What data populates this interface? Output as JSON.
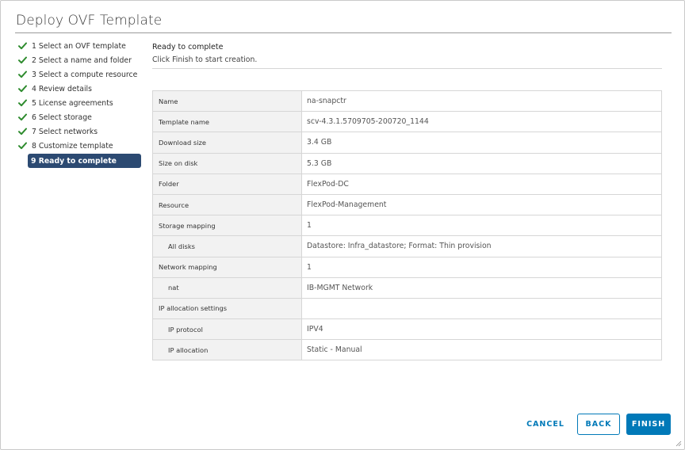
{
  "dialog": {
    "title": "Deploy OVF Template"
  },
  "steps": [
    {
      "label": "1 Select an OVF template",
      "done": true
    },
    {
      "label": "2 Select a name and folder",
      "done": true
    },
    {
      "label": "3 Select a compute resource",
      "done": true
    },
    {
      "label": "4 Review details",
      "done": true
    },
    {
      "label": "5 License agreements",
      "done": true
    },
    {
      "label": "6 Select storage",
      "done": true
    },
    {
      "label": "7 Select networks",
      "done": true
    },
    {
      "label": "8 Customize template",
      "done": true
    },
    {
      "label": "9 Ready to complete",
      "active": true
    }
  ],
  "main": {
    "title": "Ready to complete",
    "subtitle": "Click Finish to start creation."
  },
  "summary": [
    {
      "key": "Name",
      "value": "na-snapctr"
    },
    {
      "key": "Template name",
      "value": "scv-4.3.1.5709705-200720_1144"
    },
    {
      "key": "Download size",
      "value": "3.4 GB"
    },
    {
      "key": "Size on disk",
      "value": "5.3 GB"
    },
    {
      "key": "Folder",
      "value": "FlexPod-DC"
    },
    {
      "key": "Resource",
      "value": "FlexPod-Management"
    },
    {
      "key": "Storage mapping",
      "value": "1"
    },
    {
      "key": "All disks",
      "value": "Datastore: Infra_datastore; Format: Thin provision",
      "sub": true
    },
    {
      "key": "Network mapping",
      "value": "1"
    },
    {
      "key": "nat",
      "value": "IB-MGMT Network",
      "sub": true
    },
    {
      "key": "IP allocation settings",
      "value": ""
    },
    {
      "key": "IP protocol",
      "value": "IPV4",
      "sub": true
    },
    {
      "key": "IP allocation",
      "value": "Static - Manual",
      "sub": true
    }
  ],
  "footer": {
    "cancel_label": "CANCEL",
    "back_label": "BACK",
    "finish_label": "FINISH"
  },
  "colors": {
    "accent": "#0079b8",
    "active_step": "#2c4a72",
    "check": "#2e8b2e"
  },
  "icons": {
    "done": "check-icon",
    "resize": "resize-grip-icon"
  }
}
